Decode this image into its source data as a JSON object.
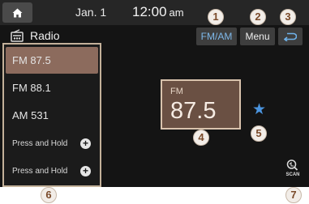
{
  "status_bar": {
    "date": "Jan. 1",
    "time": "12:00",
    "ampm": "am"
  },
  "header": {
    "title": "Radio",
    "band_toggle_label": "FM/AM",
    "menu_label": "Menu"
  },
  "presets": [
    {
      "label": "FM 87.5",
      "active": true
    },
    {
      "label": "FM 88.1",
      "active": false
    },
    {
      "label": "AM 531",
      "active": false
    },
    {
      "label": "Press and Hold",
      "active": false
    },
    {
      "label": "Press and Hold",
      "active": false
    }
  ],
  "now_playing": {
    "band": "FM",
    "frequency": "87.5",
    "favorite": true
  },
  "scan_label": "SCAN",
  "callouts": [
    "1",
    "2",
    "3",
    "4",
    "5",
    "6",
    "7"
  ],
  "colors": {
    "accent": "#8c6b5d",
    "frequency_box": "#6a5043",
    "favorite_star": "#4b95e0",
    "band_toggle_text": "#7eb8ea",
    "callout_text": "#7a4a2a"
  },
  "icons": [
    "home-icon",
    "radio-icon",
    "back-icon",
    "plus-icon",
    "star-icon",
    "scan-icon"
  ]
}
